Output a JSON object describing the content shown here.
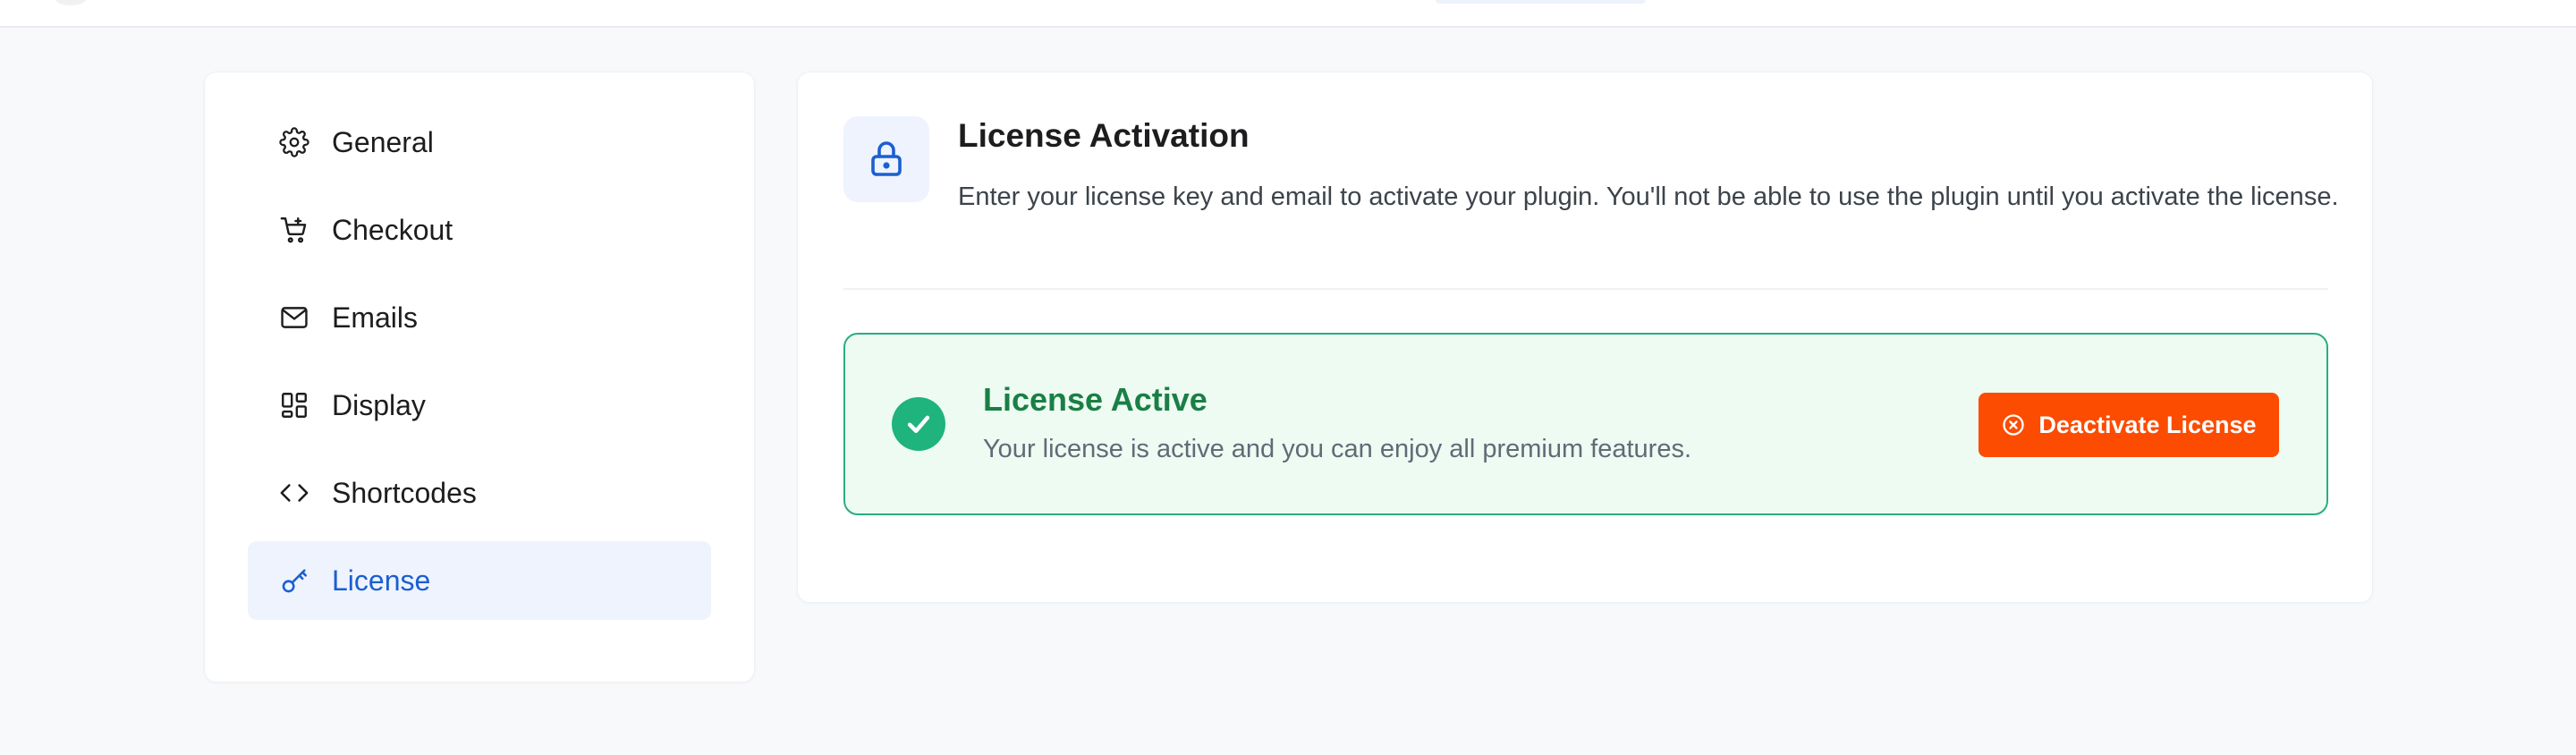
{
  "sidebar": {
    "items": [
      {
        "label": "General",
        "icon": "gear-icon",
        "active": false
      },
      {
        "label": "Checkout",
        "icon": "cart-icon",
        "active": false
      },
      {
        "label": "Emails",
        "icon": "mail-icon",
        "active": false
      },
      {
        "label": "Display",
        "icon": "layout-icon",
        "active": false
      },
      {
        "label": "Shortcodes",
        "icon": "code-icon",
        "active": false
      },
      {
        "label": "License",
        "icon": "key-icon",
        "active": true
      }
    ]
  },
  "license": {
    "header_icon": "lock-icon",
    "title": "License Activation",
    "description": "Enter your license key and email to activate your plugin. You'll not be able to use the plugin until you activate the license.",
    "status": {
      "icon": "check-circle-icon",
      "title": "License Active",
      "description": "Your license is active and you can enjoy all premium features.",
      "button_label": "Deactivate License",
      "button_icon": "x-circle-icon"
    }
  },
  "colors": {
    "accent": "#1b5fd1",
    "active_bg": "#eef3fd",
    "success_green": "#1a7f45",
    "success_bg": "#edfbf2",
    "danger_orange": "#fc4c02"
  }
}
